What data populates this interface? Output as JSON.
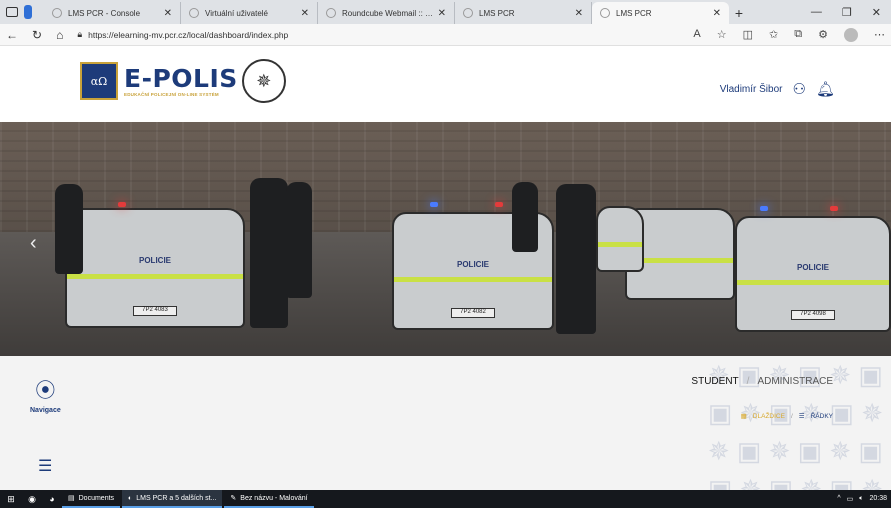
{
  "browser": {
    "tabs": [
      {
        "label": "LMS PCR - Console",
        "active": false
      },
      {
        "label": "Virtuální uživatelé",
        "active": false
      },
      {
        "label": "Roundcube Webmail :: Vítejte v R",
        "active": false
      },
      {
        "label": "LMS PCR",
        "active": false
      },
      {
        "label": "LMS PCR",
        "active": true
      }
    ],
    "url": "https://elearning-mv.pcr.cz/local/dashboard/index.php"
  },
  "site": {
    "logo_badge": "αΩ",
    "logo_title": "E-POLIS",
    "logo_subtitle": "EDUKAČNÍ POLICEJNÍ ON-LINE SYSTÉM",
    "user_name": "Vladimír Šibor"
  },
  "hero": {
    "plates": [
      "7P2 4082",
      "7P2 4098",
      "7P2 4083"
    ],
    "car_text": "POLICIE"
  },
  "content": {
    "nav_label": "Navigace",
    "role_student": "STUDENT",
    "role_separator": "/",
    "role_admin": "ADMINISTRACE",
    "view_tiles": "DLAŽDICE",
    "view_separator": "/",
    "view_rows": "ŘÁDKY"
  },
  "taskbar": {
    "items": [
      {
        "label": "Documents"
      },
      {
        "label": "LMS PCR a 5 dalších st..."
      },
      {
        "label": "Bez názvu - Malování"
      }
    ],
    "time": "20:38"
  },
  "colors": {
    "brand_blue": "#1d3b7a",
    "gold": "#c8a23a",
    "tiles_accent": "#d8a92d"
  }
}
